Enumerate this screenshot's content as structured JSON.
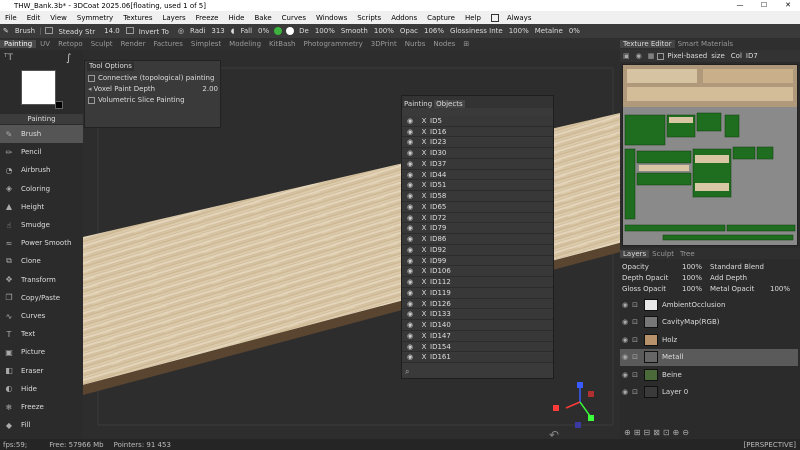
{
  "window": {
    "title": "THW_Bank.3b* - 3DCoat 2025.06[floating, used 1 of 5]",
    "controls": [
      "—",
      "☐",
      "✕"
    ]
  },
  "menu": {
    "items": [
      "File",
      "Edit",
      "View",
      "Symmetry",
      "Textures",
      "Layers",
      "Freeze",
      "Hide",
      "Bake",
      "Curves",
      "Windows",
      "Scripts",
      "Addons",
      "Capture",
      "Help"
    ],
    "always_label": "Always"
  },
  "toolbar": {
    "tool": "Brush",
    "steady": "Steady Str",
    "steady_val": "14.0",
    "invert": "Invert To",
    "radius": "Radi",
    "radius_val": "313",
    "falloff": "Fall",
    "falloff_val": "0%",
    "depth": "De",
    "depth_val": "100%",
    "smooth": "Smooth",
    "smooth_val": "100%",
    "opacity": "Opac",
    "opacity_val": "106%",
    "gloss": "Glossiness Inte",
    "gloss_val": "100%",
    "metal": "Metalne",
    "metal_val": "0%",
    "color_green": "#3cb33c",
    "color_white": "#ffffff"
  },
  "tabs": [
    "Painting",
    "UV",
    "Retopo",
    "Sculpt",
    "Render",
    "Factures",
    "Simplest",
    "Modeling",
    "KitBash",
    "Photogrammetry",
    "3DPrint",
    "Nurbs",
    "Nodes",
    "⊞"
  ],
  "leftpanel": {
    "mode_label": "Painting",
    "tools": [
      {
        "label": "Brush",
        "icon": "brush-icon",
        "glyph": "✎",
        "sel": true
      },
      {
        "label": "Pencil",
        "icon": "pencil-icon",
        "glyph": "✏"
      },
      {
        "label": "Airbrush",
        "icon": "airbrush-icon",
        "glyph": "◔"
      },
      {
        "label": "Coloring",
        "icon": "coloring-icon",
        "glyph": "◈"
      },
      {
        "label": "Height",
        "icon": "height-icon",
        "glyph": "▲"
      },
      {
        "label": "Smudge",
        "icon": "smudge-icon",
        "glyph": "☝"
      },
      {
        "label": "Power Smooth",
        "icon": "power-smooth-icon",
        "glyph": "≈"
      },
      {
        "label": "Clone",
        "icon": "clone-icon",
        "glyph": "⧉"
      },
      {
        "label": "Transform",
        "icon": "transform-icon",
        "glyph": "✥"
      },
      {
        "label": "Copy/Paste",
        "icon": "copy-paste-icon",
        "glyph": "❐"
      },
      {
        "label": "Curves",
        "icon": "curves-icon",
        "glyph": "∿"
      },
      {
        "label": "Text",
        "icon": "text-icon",
        "glyph": "T"
      },
      {
        "label": "Picture",
        "icon": "picture-icon",
        "glyph": "▣"
      },
      {
        "label": "Eraser",
        "icon": "eraser-icon",
        "glyph": "◧"
      },
      {
        "label": "Hide",
        "icon": "hide-icon",
        "glyph": "◐"
      },
      {
        "label": "Freeze",
        "icon": "freeze-icon",
        "glyph": "❄"
      },
      {
        "label": "Fill",
        "icon": "fill-icon",
        "glyph": "◆"
      }
    ]
  },
  "tooloptions": {
    "tabs": [
      "Tool",
      "Options"
    ],
    "connective": "Connective (topological) painting",
    "voxel_label": "Voxel Paint Depth",
    "voxel_val": "2.00",
    "volumetric": "Volumetric Slice Painting"
  },
  "objects": {
    "tabs": [
      "Painting",
      "Objects"
    ],
    "items": [
      "ID5",
      "ID16",
      "ID23",
      "ID30",
      "ID37",
      "ID44",
      "ID51",
      "ID58",
      "ID65",
      "ID72",
      "ID79",
      "ID86",
      "ID92",
      "ID99",
      "ID106",
      "ID112",
      "ID119",
      "ID126",
      "ID133",
      "ID140",
      "ID147",
      "ID154",
      "ID161"
    ]
  },
  "rightpanel": {
    "tabs": [
      "Texture Editor",
      "Smart Materials"
    ],
    "pixel_based": "Pixel-based",
    "size": "size",
    "col": "Col",
    "id_sel": "ID7",
    "layer_tabs": [
      "Layers",
      "Sculpt",
      "Tree"
    ],
    "opacity_label": "Opacity",
    "opacity_val": "100%",
    "blend": "Standard Blend",
    "depth_label": "Depth Opacit",
    "depth_val": "100%",
    "add_depth": "Add Depth",
    "gloss_label": "Gloss Opacit",
    "gloss_val": "100%",
    "metal_label": "Metal Opacit",
    "metal_val": "100%",
    "layers": [
      {
        "name": "AmbientOcclusion",
        "thumb": "#e8e8e8"
      },
      {
        "name": "CavityMap(RGB)",
        "thumb": "#777777"
      },
      {
        "name": "Holz",
        "thumb": "#b8926a"
      },
      {
        "name": "Metall",
        "thumb": "#666666",
        "sel": true
      },
      {
        "name": "Beine",
        "thumb": "#4a6a3a"
      },
      {
        "name": "Layer 0",
        "thumb": "#3a3a3a"
      }
    ]
  },
  "viewport": {
    "perspective": "[PERSPECTIVE]"
  },
  "status": {
    "fps": "fps:59;",
    "free": "Free: 57966 Mb",
    "pointers": "Pointers: 91 453"
  }
}
